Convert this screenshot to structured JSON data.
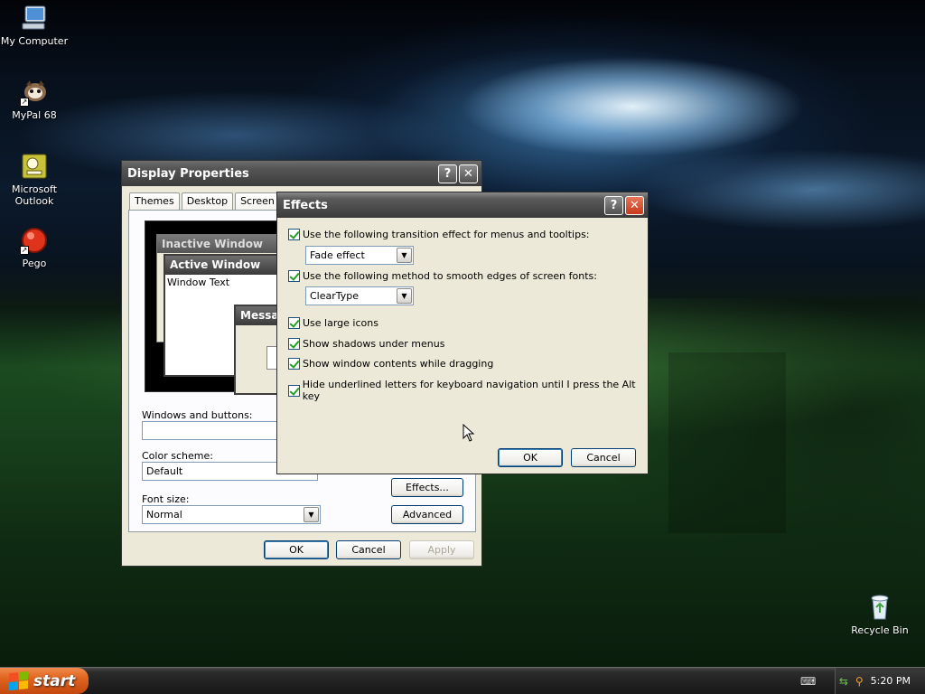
{
  "desktop": {
    "icons": [
      {
        "label": "My Computer",
        "icon": "computer-icon"
      },
      {
        "label": "MyPal 68",
        "icon": "mypal-browser-icon"
      },
      {
        "label": "Microsoft Outlook",
        "icon": "outlook-icon"
      },
      {
        "label": "Pego",
        "icon": "pego-icon"
      },
      {
        "label": "Recycle Bin",
        "icon": "recycle-bin-icon"
      }
    ]
  },
  "display_properties": {
    "title": "Display Properties",
    "tabs": [
      "Themes",
      "Desktop",
      "Screen Sav"
    ],
    "preview": {
      "inactive_window": "Inactive Window",
      "active_window": "Active Window",
      "window_text": "Window Text",
      "message_box": "Messag"
    },
    "windows_and_buttons_label": "Windows and buttons:",
    "color_scheme_label": "Color scheme:",
    "color_scheme_value": "Default",
    "font_size_label": "Font size:",
    "font_size_value": "Normal",
    "effects_button": "Effects...",
    "advanced_button": "Advanced",
    "ok": "OK",
    "cancel": "Cancel",
    "apply": "Apply"
  },
  "effects": {
    "title": "Effects",
    "transition_label": "Use the following transition effect for menus and tooltips:",
    "transition_value": "Fade effect",
    "smooth_label": "Use the following method to smooth edges of screen fonts:",
    "smooth_value": "ClearType",
    "large_icons": "Use large icons",
    "shadows": "Show shadows under menus",
    "window_contents": "Show window contents while dragging",
    "hide_underlined": "Hide underlined letters for keyboard navigation until I press the Alt key",
    "ok": "OK",
    "cancel": "Cancel"
  },
  "taskbar": {
    "start": "start",
    "clock": "5:20 PM"
  }
}
